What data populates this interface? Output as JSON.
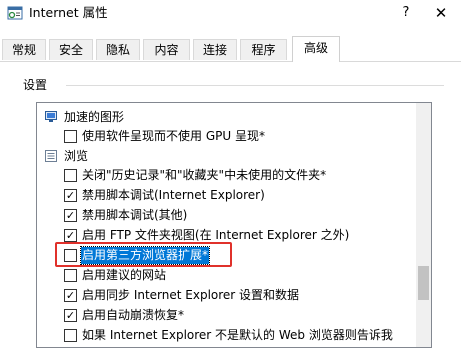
{
  "window": {
    "title": "Internet 属性",
    "help_glyph": "?",
    "close_glyph": "✕"
  },
  "tabs": [
    {
      "label": "常规"
    },
    {
      "label": "安全"
    },
    {
      "label": "隐私"
    },
    {
      "label": "内容"
    },
    {
      "label": "连接"
    },
    {
      "label": "程序"
    },
    {
      "label": "高级",
      "active": true
    }
  ],
  "settings_group": {
    "label": "设置"
  },
  "settings_list": [
    {
      "type": "category",
      "label": "加速的图形",
      "icon": "monitor-icon"
    },
    {
      "type": "checkbox",
      "label": "使用软件呈现而不使用 GPU 呈现*",
      "checked": false
    },
    {
      "type": "category",
      "label": "浏览",
      "icon": "list-icon"
    },
    {
      "type": "checkbox",
      "label": "关闭\"历史记录\"和\"收藏夹\"中未使用的文件夹*",
      "checked": false
    },
    {
      "type": "checkbox",
      "label": "禁用脚本调试(Internet Explorer)",
      "checked": true
    },
    {
      "type": "checkbox",
      "label": "禁用脚本调试(其他)",
      "checked": true
    },
    {
      "type": "checkbox",
      "label": "启用 FTP 文件夹视图(在 Internet Explorer 之外)",
      "checked": true
    },
    {
      "type": "checkbox",
      "label": "启用第三方浏览器扩展*",
      "checked": false,
      "selected": true,
      "highlighted": true
    },
    {
      "type": "checkbox",
      "label": "启用建议的网站",
      "checked": false
    },
    {
      "type": "checkbox",
      "label": "启用同步 Internet Explorer 设置和数据",
      "checked": true
    },
    {
      "type": "checkbox",
      "label": "启用自动崩溃恢复*",
      "checked": true
    },
    {
      "type": "checkbox",
      "label": "如果 Internet Explorer 不是默认的 Web 浏览器则告诉我",
      "checked": false
    }
  ],
  "colors": {
    "selection": "#0078d7",
    "highlight_box": "#e0312b"
  }
}
